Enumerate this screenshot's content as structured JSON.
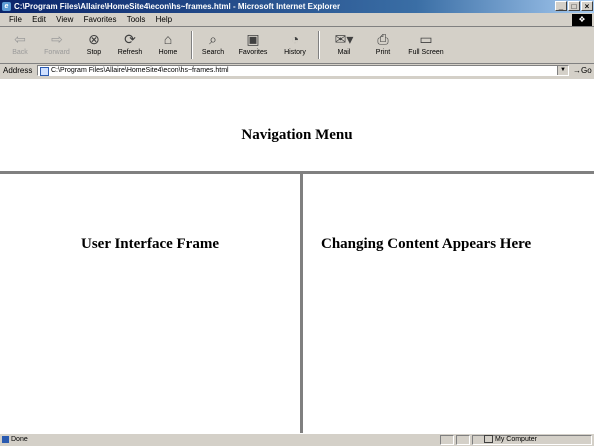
{
  "window": {
    "title": "C:\\Program Files\\Allaire\\HomeSite4\\econ\\hs~frames.html - Microsoft Internet Explorer",
    "controls": [
      "_",
      "□",
      "×"
    ]
  },
  "menu": {
    "items": [
      "File",
      "Edit",
      "View",
      "Favorites",
      "Tools",
      "Help"
    ]
  },
  "toolbar": {
    "back": "Back",
    "forward": "Forward",
    "stop": "Stop",
    "refresh": "Refresh",
    "home": "Home",
    "search": "Search",
    "favorites": "Favorites",
    "history": "History",
    "mail": "Mail",
    "print": "Print",
    "fullscreen": "Full Screen"
  },
  "address": {
    "label": "Address",
    "url": "C:\\Program Files\\Allaire\\HomeSite4\\econ\\hs~frames.html",
    "go": "Go"
  },
  "frames": {
    "top_heading": "Navigation Menu",
    "left_heading": "User Interface Frame",
    "right_heading": "Changing Content Appears Here"
  },
  "status": {
    "text": "Done",
    "zone": "My Computer"
  }
}
